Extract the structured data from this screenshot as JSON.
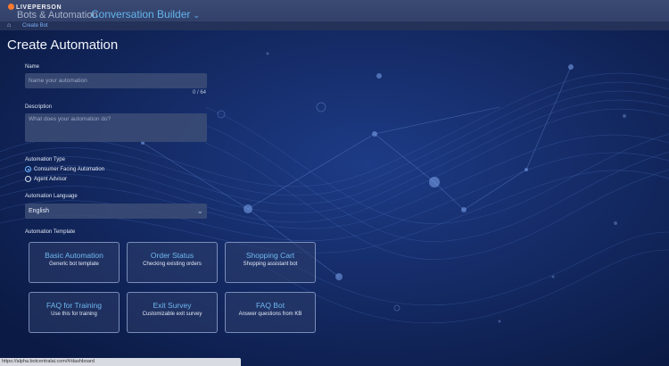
{
  "header": {
    "logo_text": "LIVEPERSON",
    "app_title": "Bots & Automation",
    "section": "Conversation Builder",
    "breadcrumb": "Create Bot"
  },
  "page": {
    "title": "Create Automation"
  },
  "form": {
    "name_label": "Name",
    "name_placeholder": "Name your automation",
    "name_counter": "0 / 64",
    "description_label": "Description",
    "description_placeholder": "What does your automation do?",
    "type_label": "Automation Type",
    "type_options": [
      {
        "label": "Consumer Facing Automation",
        "selected": true
      },
      {
        "label": "Agent Advisor",
        "selected": false
      }
    ],
    "language_label": "Automation Language",
    "language_value": "English",
    "template_label": "Automation Template"
  },
  "templates": [
    {
      "title": "Basic Automation",
      "subtitle": "Generic bot template"
    },
    {
      "title": "Order Status",
      "subtitle": "Checking existing orders"
    },
    {
      "title": "Shopping Cart",
      "subtitle": "Shopping assistant bot"
    },
    {
      "title": "FAQ for Training",
      "subtitle": "Use this for training"
    },
    {
      "title": "Exit Survey",
      "subtitle": "Customizable exit survey"
    },
    {
      "title": "FAQ Bot",
      "subtitle": "Answer questions from KB"
    }
  ],
  "status_url": "https://alpha.botcentralai.com/#/dashboard",
  "colors": {
    "accent": "#63b5ef",
    "brand_dot": "#ff7a2e",
    "background": "#0e1f4f"
  }
}
